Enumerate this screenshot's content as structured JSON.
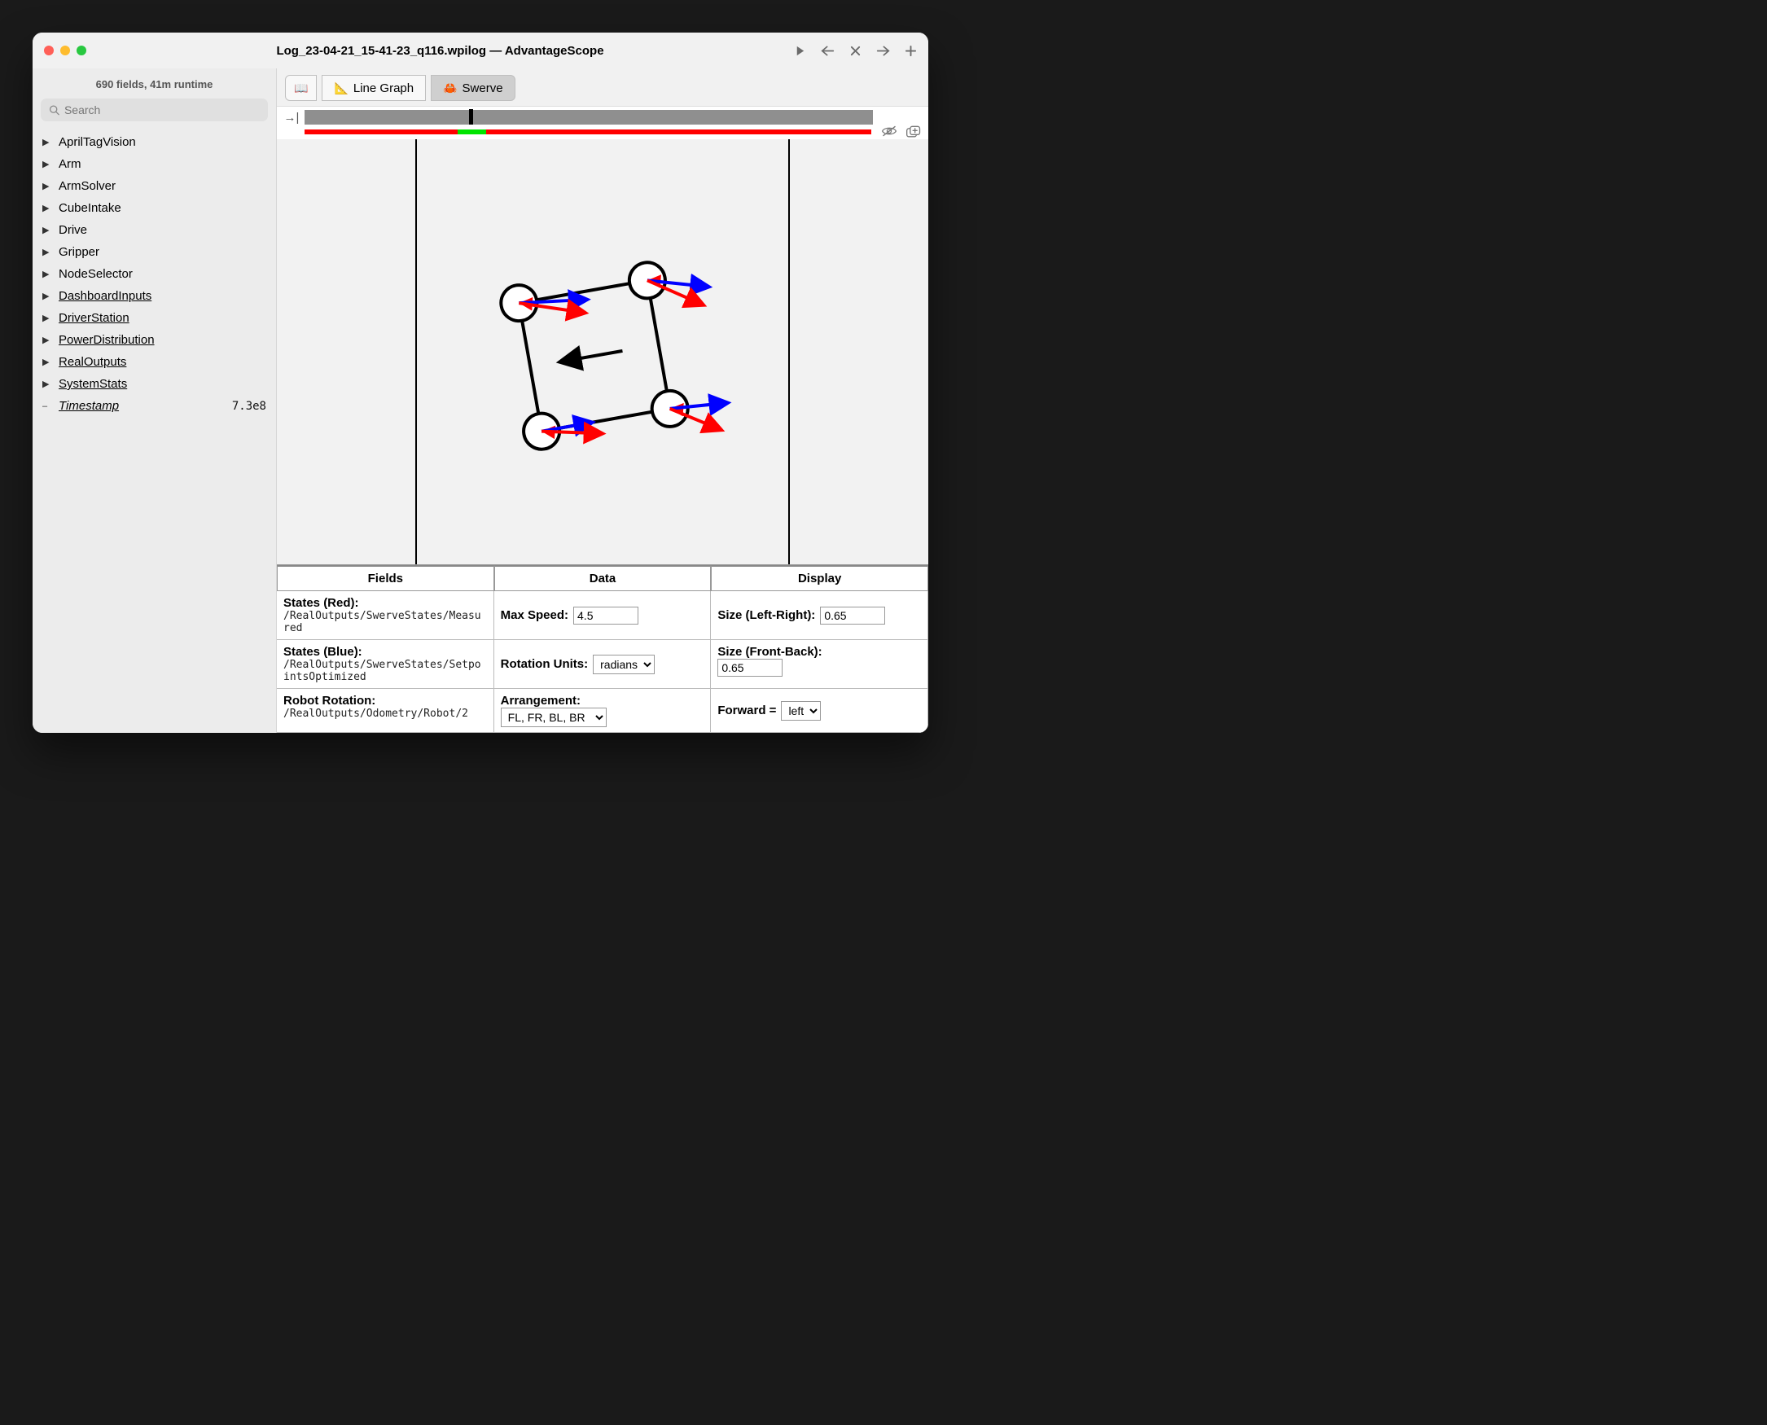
{
  "window": {
    "title": "Log_23-04-21_15-41-23_q116.wpilog — AdvantageScope"
  },
  "sidebar": {
    "summary": "690 fields, 41m runtime",
    "search_placeholder": "Search",
    "items": [
      {
        "label": "AprilTagVision",
        "arrow": "▶",
        "underlined": false
      },
      {
        "label": "Arm",
        "arrow": "▶",
        "underlined": false
      },
      {
        "label": "ArmSolver",
        "arrow": "▶",
        "underlined": false
      },
      {
        "label": "CubeIntake",
        "arrow": "▶",
        "underlined": false
      },
      {
        "label": "Drive",
        "arrow": "▶",
        "underlined": false
      },
      {
        "label": "Gripper",
        "arrow": "▶",
        "underlined": false
      },
      {
        "label": "NodeSelector",
        "arrow": "▶",
        "underlined": false
      },
      {
        "label": "DashboardInputs",
        "arrow": "▶",
        "underlined": true
      },
      {
        "label": "DriverStation",
        "arrow": "▶",
        "underlined": true
      },
      {
        "label": "PowerDistribution",
        "arrow": "▶",
        "underlined": true
      },
      {
        "label": "RealOutputs",
        "arrow": "▶",
        "underlined": true
      },
      {
        "label": "SystemStats",
        "arrow": "▶",
        "underlined": true
      },
      {
        "label": "Timestamp",
        "arrow": "–",
        "underlined": true,
        "italic": true,
        "value": "7.3e8"
      }
    ]
  },
  "tabs": [
    {
      "icon": "📖",
      "label": "",
      "kind": "icon-only"
    },
    {
      "icon": "📐",
      "label": "Line Graph",
      "kind": "normal"
    },
    {
      "icon": "🦀",
      "label": "Swerve",
      "kind": "active"
    }
  ],
  "timeline": {
    "cursor_pct": 29,
    "green_segments": [
      {
        "left_pct": 27,
        "width_pct": 5
      }
    ]
  },
  "config": {
    "headers": [
      "Fields",
      "Data",
      "Display"
    ],
    "rows": [
      {
        "field_label": "States (Red):",
        "field_path": "/RealOutputs/SwerveStates/Measured",
        "data_label": "Max Speed:",
        "data_input": "4.5",
        "display_label": "Size (Left-Right):",
        "display_input": "0.65"
      },
      {
        "field_label": "States (Blue):",
        "field_path": "/RealOutputs/SwerveStates/SetpointsOptimized",
        "data_label": "Rotation Units:",
        "data_select": "radians",
        "display_label": "Size (Front-Back):",
        "display_input": "0.65"
      },
      {
        "field_label": "Robot Rotation:",
        "field_path": "/RealOutputs/Odometry/Robot/2",
        "data_label": "Arrangement:",
        "data_select": "FL, FR, BL, BR",
        "display_label": "Forward =",
        "display_select": "left"
      }
    ]
  },
  "chart_data": {
    "type": "diagram",
    "description": "Swerve drive visualization: square robot frame rotated ~CCW 10°, four wheel modules at corners, center arrow pointing left (forward direction). Each module shows two velocity vectors: red = measured states, blue = setpoints.",
    "robot_rotation_deg": 10,
    "forward_direction": "left",
    "modules": [
      {
        "name": "FL",
        "position": [
          -1,
          1
        ]
      },
      {
        "name": "FR",
        "position": [
          1,
          1
        ]
      },
      {
        "name": "BL",
        "position": [
          -1,
          -1
        ]
      },
      {
        "name": "BR",
        "position": [
          1,
          -1
        ]
      }
    ],
    "vector_colors": {
      "measured": "#ff0000",
      "setpoint": "#0000ff"
    }
  }
}
